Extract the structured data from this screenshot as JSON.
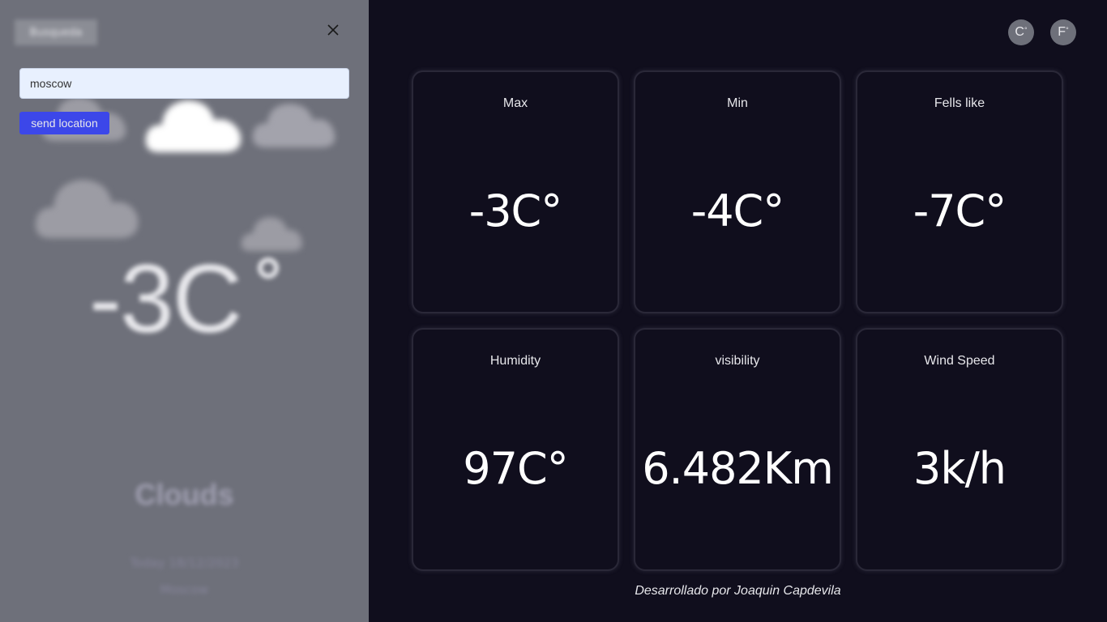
{
  "sidebar": {
    "search_toggle_label": "Busqueda",
    "search_input": {
      "value": "moscow",
      "placeholder": ""
    },
    "send_button_label": "send location",
    "current_temp": "-3C",
    "condition": "Clouds",
    "date": "Today 18/12/2023",
    "location": "Moscow"
  },
  "units": {
    "celsius": "C",
    "fahrenheit": "F"
  },
  "cards": [
    {
      "label": "Max",
      "value": "-3C°"
    },
    {
      "label": "Min",
      "value": "-4C°"
    },
    {
      "label": "Fells like",
      "value": "-7C°"
    },
    {
      "label": "Humidity",
      "value": "97C°"
    },
    {
      "label": "visibility",
      "value": "6.482Km"
    },
    {
      "label": "Wind Speed",
      "value": "3k/h"
    }
  ],
  "footer": "Desarrollado por Joaquin Capdevila",
  "colors": {
    "sidebar_bg": "#6e707a",
    "main_bg": "#100e1d",
    "accent_button": "#3c47e9",
    "input_bg": "#e8f0fe"
  },
  "icons": {
    "close": "close-icon",
    "cloud": "cloud-icon"
  }
}
